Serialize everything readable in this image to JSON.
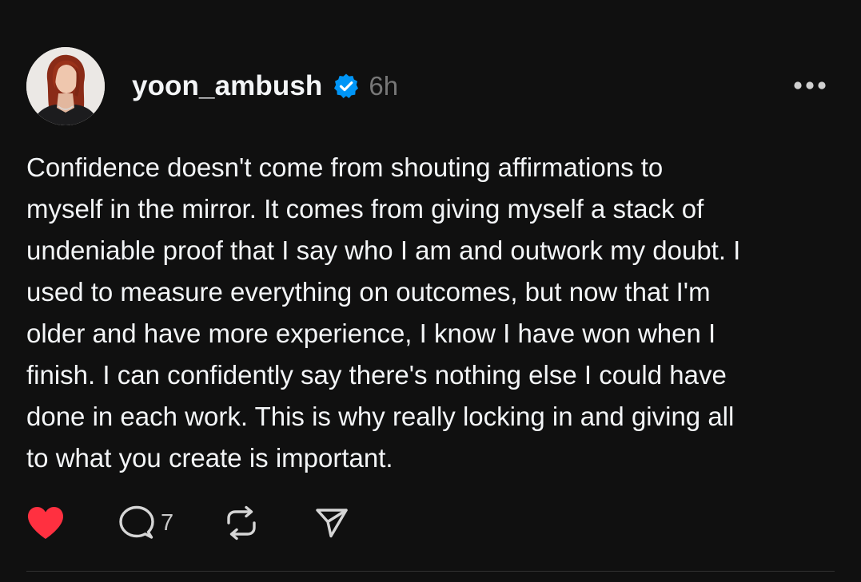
{
  "post": {
    "author": {
      "username": "yoon_ambush",
      "verified": true,
      "avatar_icon": "profile-photo"
    },
    "timestamp": "6h",
    "more_icon": "ellipsis-icon",
    "text": "Confidence doesn't come from shouting affirmations to\nmyself in the mirror. It comes from giving myself a stack of\nundeniable proof that I say who I am and outwork my doubt. I\nused to measure everything on outcomes, but now that I'm\nolder and have more experience, I know I have won when I\nfinish. I can confidently say there's nothing else I could have\ndone in each work. This is why really locking in and giving all\nto what you create is important.",
    "actions": {
      "like": {
        "icon": "heart-icon",
        "liked": true,
        "color": "#ff3040"
      },
      "reply": {
        "icon": "comment-icon",
        "count": "7"
      },
      "repost": {
        "icon": "repost-icon"
      },
      "share": {
        "icon": "send-icon"
      }
    }
  },
  "colors": {
    "background": "#101010",
    "text": "#f3f5f7",
    "muted": "#777777",
    "verified": "#0095f6",
    "like": "#ff3040",
    "divider": "#323232"
  }
}
